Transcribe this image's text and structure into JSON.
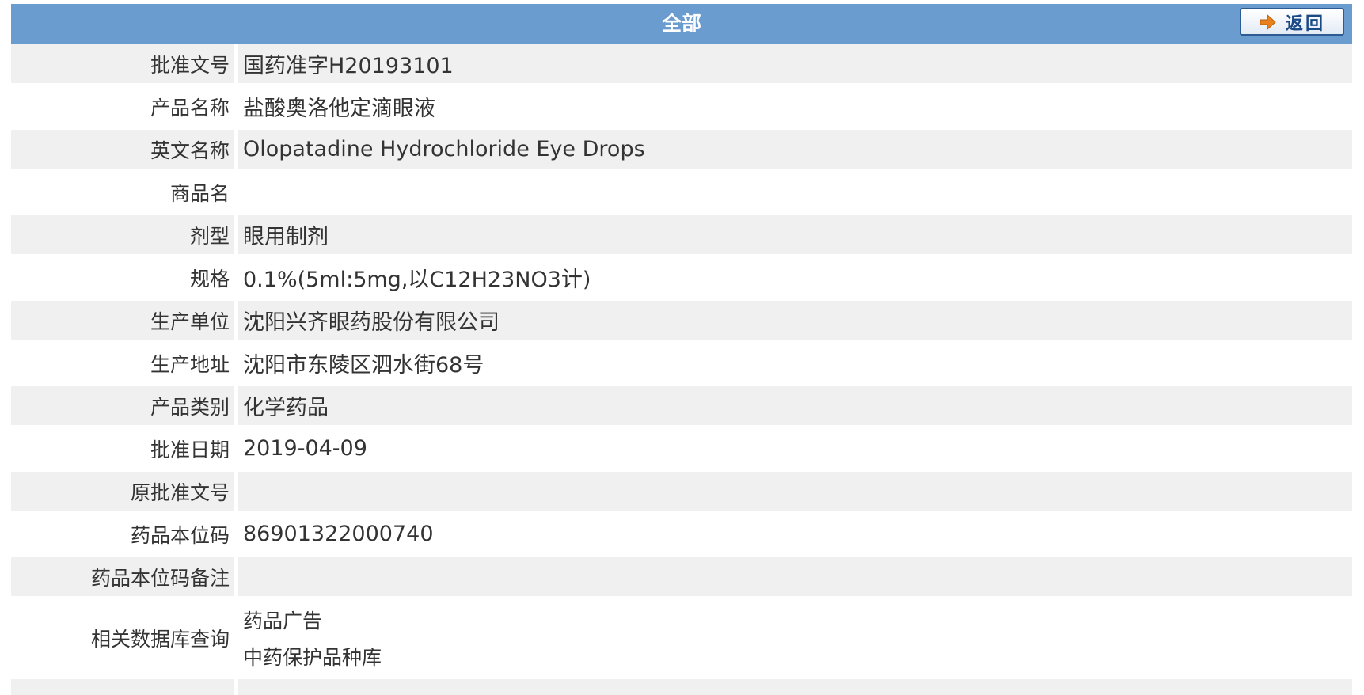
{
  "header": {
    "title": "全部",
    "back_label": "返回"
  },
  "rows": [
    {
      "label": "批准文号",
      "value": "国药准字H20193101"
    },
    {
      "label": "产品名称",
      "value": "盐酸奥洛他定滴眼液"
    },
    {
      "label": "英文名称",
      "value": "Olopatadine Hydrochloride Eye Drops"
    },
    {
      "label": "商品名",
      "value": ""
    },
    {
      "label": "剂型",
      "value": "眼用制剂"
    },
    {
      "label": "规格",
      "value": "0.1%(5ml:5mg,以C12H23NO3计)"
    },
    {
      "label": "生产单位",
      "value": "沈阳兴齐眼药股份有限公司"
    },
    {
      "label": "生产地址",
      "value": "沈阳市东陵区泗水街68号"
    },
    {
      "label": "产品类别",
      "value": "化学药品"
    },
    {
      "label": "批准日期",
      "value": "2019-04-09"
    },
    {
      "label": "原批准文号",
      "value": ""
    },
    {
      "label": "药品本位码",
      "value": "86901322000740"
    },
    {
      "label": "药品本位码备注",
      "value": ""
    }
  ],
  "related": {
    "label": "相关数据库查询",
    "links": [
      "药品广告",
      "中药保护品种库"
    ]
  },
  "colors": {
    "header_bg": "#6b9ccf",
    "row_alt_bg": "#f0f0f0",
    "button_border": "#2d5c93",
    "arrow": "#e8801c"
  }
}
